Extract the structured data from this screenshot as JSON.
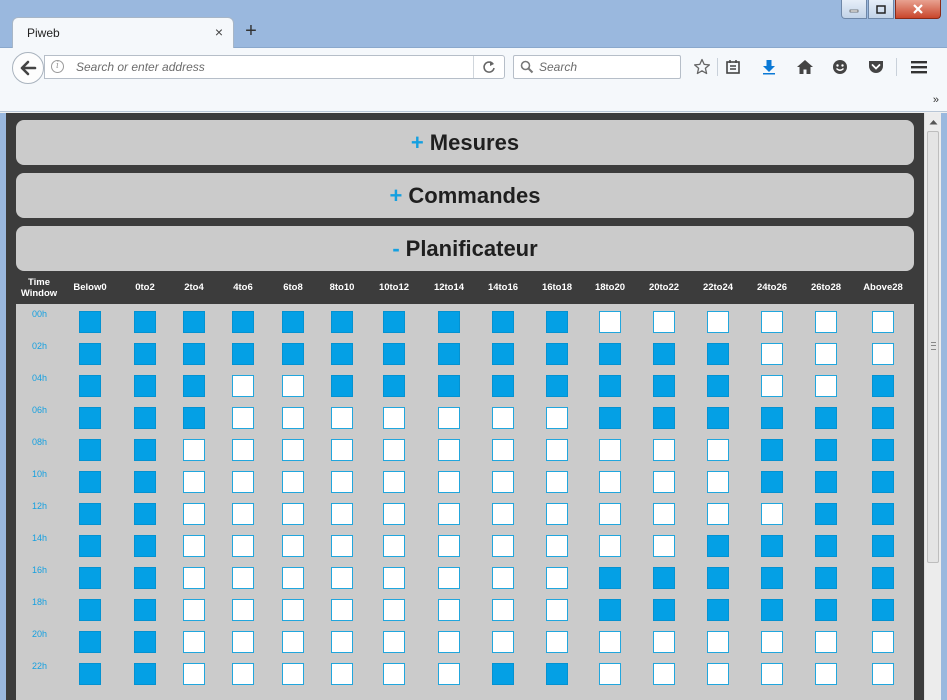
{
  "browser": {
    "tab_title": "Piweb",
    "tab_close": "×",
    "new_tab": "+",
    "url_placeholder": "Search or enter address",
    "search_placeholder": "Search",
    "overflow": "»",
    "info_glyph": "i"
  },
  "panels": [
    {
      "sign": "+",
      "title": "Mesures"
    },
    {
      "sign": "+",
      "title": "Commandes"
    },
    {
      "sign": "-",
      "title": "Planificateur"
    }
  ],
  "schedule": {
    "corner_label_1": "Time",
    "corner_label_2": "Window",
    "columns": [
      "Below0",
      "0to2",
      "2to4",
      "4to6",
      "6to8",
      "8to10",
      "10to12",
      "12to14",
      "14to16",
      "16to18",
      "18to20",
      "20to22",
      "22to24",
      "24to26",
      "26to28",
      "Above28"
    ],
    "rows": [
      {
        "time": "00h",
        "cells": [
          1,
          1,
          1,
          1,
          1,
          1,
          1,
          1,
          1,
          1,
          0,
          0,
          0,
          0,
          0,
          0
        ]
      },
      {
        "time": "02h",
        "cells": [
          1,
          1,
          1,
          1,
          1,
          1,
          1,
          1,
          1,
          1,
          1,
          1,
          1,
          0,
          0,
          0
        ]
      },
      {
        "time": "04h",
        "cells": [
          1,
          1,
          1,
          0,
          0,
          1,
          1,
          1,
          1,
          1,
          1,
          1,
          1,
          0,
          0,
          1
        ]
      },
      {
        "time": "06h",
        "cells": [
          1,
          1,
          1,
          0,
          0,
          0,
          0,
          0,
          0,
          0,
          1,
          1,
          1,
          1,
          1,
          1
        ]
      },
      {
        "time": "08h",
        "cells": [
          1,
          1,
          0,
          0,
          0,
          0,
          0,
          0,
          0,
          0,
          0,
          0,
          0,
          1,
          1,
          1
        ]
      },
      {
        "time": "10h",
        "cells": [
          1,
          1,
          0,
          0,
          0,
          0,
          0,
          0,
          0,
          0,
          0,
          0,
          0,
          1,
          1,
          1
        ]
      },
      {
        "time": "12h",
        "cells": [
          1,
          1,
          0,
          0,
          0,
          0,
          0,
          0,
          0,
          0,
          0,
          0,
          0,
          0,
          1,
          1
        ]
      },
      {
        "time": "14h",
        "cells": [
          1,
          1,
          0,
          0,
          0,
          0,
          0,
          0,
          0,
          0,
          0,
          0,
          1,
          1,
          1,
          1
        ]
      },
      {
        "time": "16h",
        "cells": [
          1,
          1,
          0,
          0,
          0,
          0,
          0,
          0,
          0,
          0,
          1,
          1,
          1,
          1,
          1,
          1
        ]
      },
      {
        "time": "18h",
        "cells": [
          1,
          1,
          0,
          0,
          0,
          0,
          0,
          0,
          0,
          0,
          1,
          1,
          1,
          1,
          1,
          1
        ]
      },
      {
        "time": "20h",
        "cells": [
          1,
          1,
          0,
          0,
          0,
          0,
          0,
          0,
          0,
          0,
          0,
          0,
          0,
          0,
          0,
          0
        ]
      },
      {
        "time": "22h",
        "cells": [
          1,
          1,
          0,
          0,
          0,
          0,
          0,
          0,
          1,
          1,
          0,
          0,
          0,
          0,
          0,
          0
        ]
      }
    ]
  },
  "colors": {
    "accent": "#04a0e5",
    "panel_bg": "#cbcbcb",
    "page_bg": "#3c3c3c"
  },
  "icons": [
    "back-arrow-icon",
    "info-icon",
    "reload-icon",
    "search-icon",
    "bookmark-star-icon",
    "reading-list-icon",
    "download-icon",
    "home-icon",
    "emoji-icon",
    "pocket-icon",
    "menu-icon"
  ]
}
